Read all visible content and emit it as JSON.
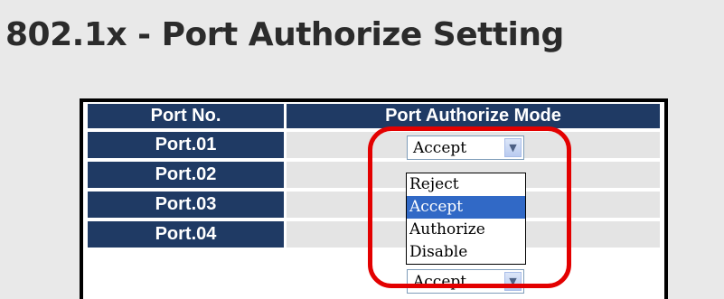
{
  "page": {
    "title": "802.1x - Port Authorize Setting"
  },
  "table": {
    "headers": [
      "Port No.",
      "Port Authorize Mode"
    ],
    "rows": [
      {
        "port": "Port.01",
        "mode": "Accept"
      },
      {
        "port": "Port.02",
        "mode": ""
      },
      {
        "port": "Port.03",
        "mode": ""
      },
      {
        "port": "Port.04",
        "mode": "Accept"
      }
    ]
  },
  "dropdown": {
    "options": [
      "Reject",
      "Accept",
      "Authorize",
      "Disable"
    ],
    "selected": "Accept"
  },
  "colors": {
    "header_bg": "#1f3a64",
    "highlight": "#e30000",
    "selected_option": "#3169c6"
  }
}
